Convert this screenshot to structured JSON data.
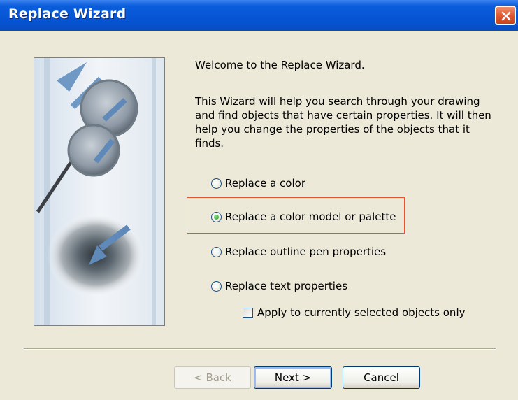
{
  "window": {
    "title": "Replace Wizard"
  },
  "content": {
    "welcome": "Welcome to the Replace Wizard.",
    "description_lines": [
      "This Wizard will help you search through your drawing",
      "and find objects that have certain properties. It will then",
      "help you change the properties of the objects that it",
      "finds."
    ]
  },
  "options": [
    {
      "label": "Replace a color",
      "selected": false
    },
    {
      "label": "Replace a color model or palette",
      "selected": true
    },
    {
      "label": "Replace outline pen properties",
      "selected": false
    },
    {
      "label": "Replace text properties",
      "selected": false
    }
  ],
  "checkbox": {
    "label": "Apply to currently selected objects only",
    "checked": false
  },
  "buttons": {
    "back": "< Back",
    "next": "Next >",
    "cancel": "Cancel"
  },
  "colors": {
    "titlebar": "#0653d2",
    "highlight": "#e8552b",
    "face": "#ece9d8"
  }
}
